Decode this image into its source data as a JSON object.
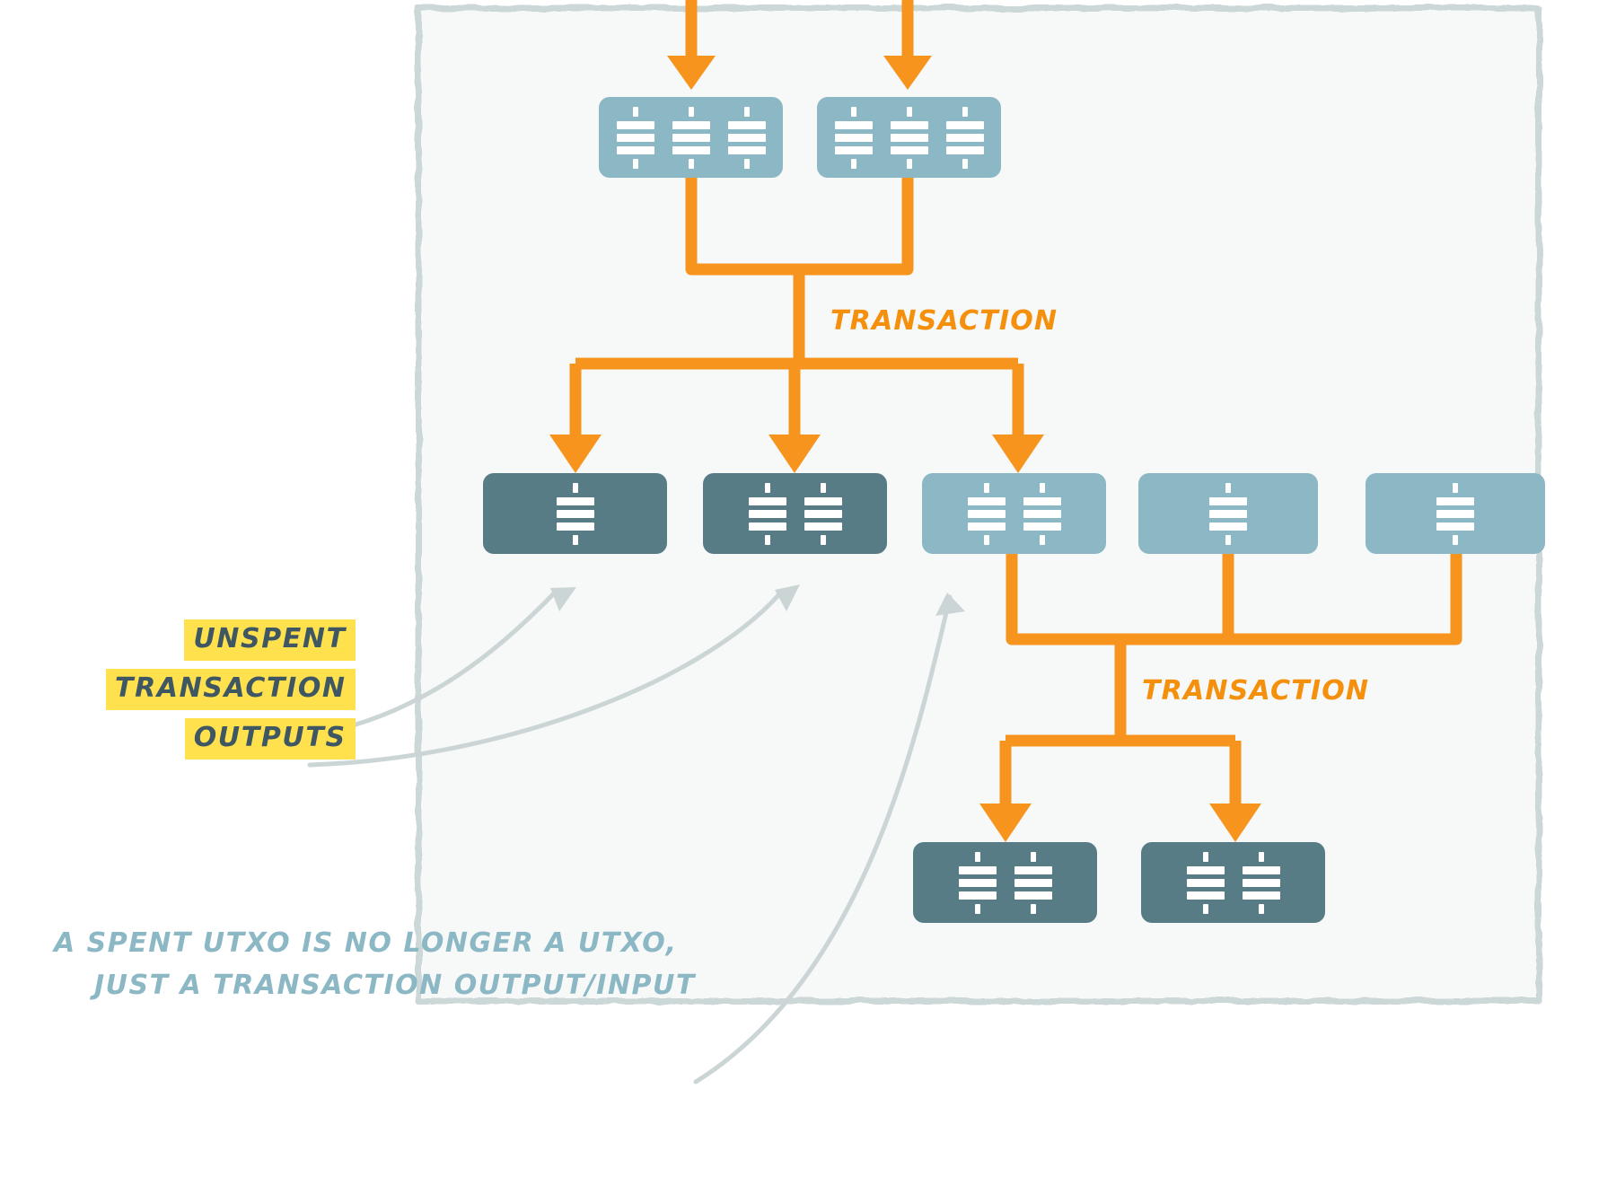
{
  "diagram": {
    "title": "UTXO transaction chain",
    "type": "flow-diagram",
    "colors": {
      "accent_orange": "#f5900c",
      "node_light": "#8bb8c4",
      "node_dark": "#587c86",
      "highlight_yellow": "#ffe14d",
      "highlight_text": "#3f5763",
      "caption_teal": "#8bb8c4",
      "panel_bg": "#f7f8f8",
      "page_bg": "#ffffff",
      "arrow_grey": "#ccd5d5"
    },
    "panel": {
      "label": "diagram-panel"
    },
    "rows": {
      "top": {
        "name": "inputs-row",
        "nodes": [
          {
            "id": "in-1",
            "state": "light",
            "coins": 3
          },
          {
            "id": "in-2",
            "state": "light",
            "coins": 3
          }
        ]
      },
      "middle": {
        "name": "outputs-row",
        "nodes": [
          {
            "id": "mid-1",
            "state": "dark",
            "coins": 1
          },
          {
            "id": "mid-2",
            "state": "dark",
            "coins": 2
          },
          {
            "id": "mid-3",
            "state": "light",
            "coins": 2
          },
          {
            "id": "mid-4",
            "state": "light",
            "coins": 1
          },
          {
            "id": "mid-5",
            "state": "light",
            "coins": 1
          }
        ]
      },
      "bottom": {
        "name": "final-outputs-row",
        "nodes": [
          {
            "id": "bot-1",
            "state": "dark",
            "coins": 2
          },
          {
            "id": "bot-2",
            "state": "dark",
            "coins": 2
          }
        ]
      }
    },
    "labels": {
      "transaction_1": "TRANSACTION",
      "transaction_2": "TRANSACTION"
    },
    "highlight": {
      "line_1": "UNSPENT",
      "line_2": "TRANSACTION",
      "line_3": "OUTPUTS"
    },
    "caption": {
      "line_1": "A SPENT UTXO IS NO LONGER A UTXO,",
      "line_2": "JUST A TRANSACTION OUTPUT/INPUT"
    }
  }
}
